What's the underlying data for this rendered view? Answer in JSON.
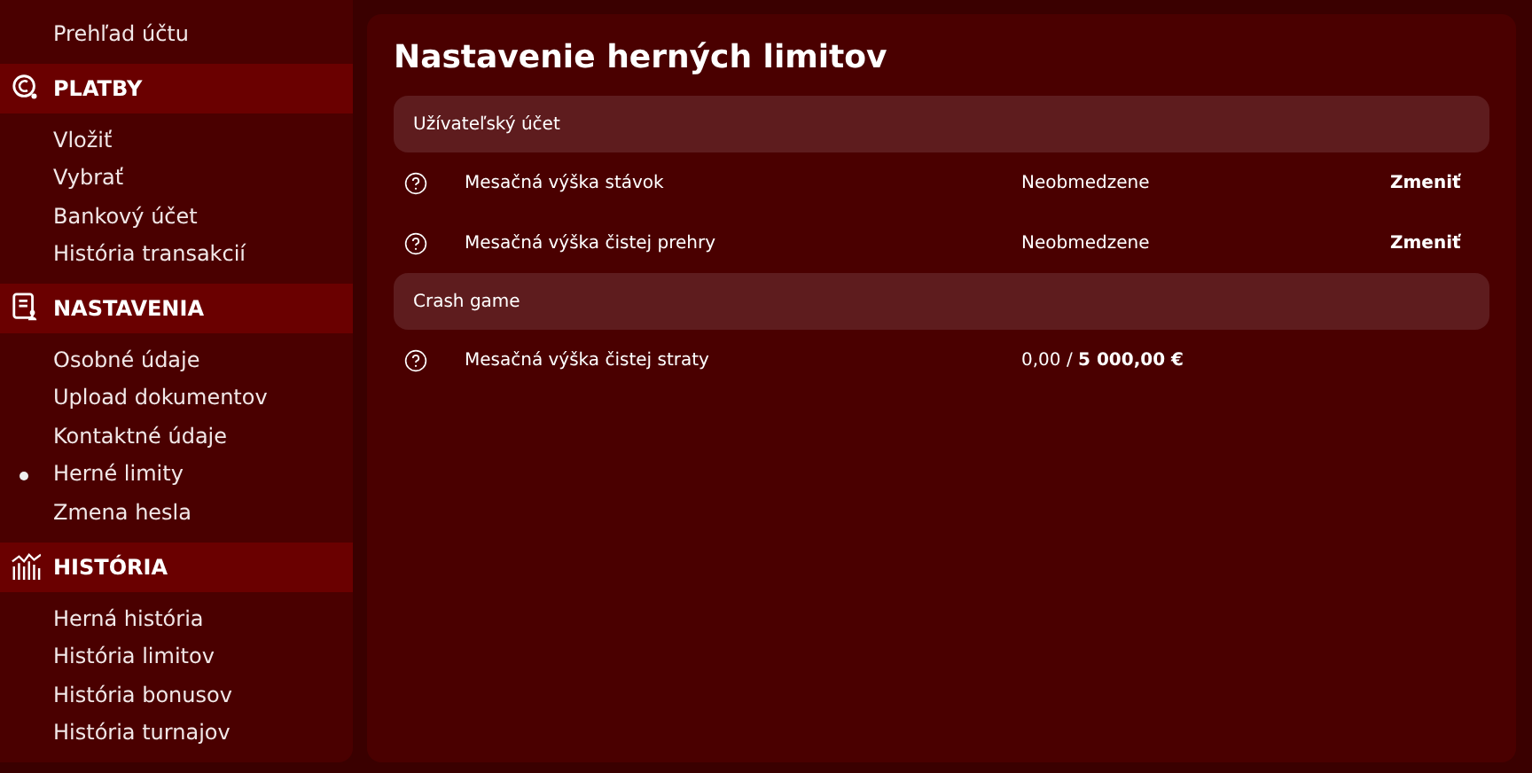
{
  "sidebar": {
    "groups": [
      {
        "items": [
          {
            "label": "Prehľad účtu",
            "selected": false
          }
        ]
      },
      {
        "title": "PLATBY",
        "kind": "payments",
        "items": [
          {
            "label": "Vložiť",
            "selected": false
          },
          {
            "label": "Vybrať",
            "selected": false
          },
          {
            "label": "Bankový účet",
            "selected": false
          },
          {
            "label": "História transakcií",
            "selected": false
          }
        ]
      },
      {
        "title": "NASTAVENIA",
        "kind": "settings",
        "items": [
          {
            "label": "Osobné údaje",
            "selected": false
          },
          {
            "label": "Upload dokumentov",
            "selected": false
          },
          {
            "label": "Kontaktné údaje",
            "selected": false
          },
          {
            "label": "Herné limity",
            "selected": true
          },
          {
            "label": "Zmena hesla",
            "selected": false
          }
        ]
      },
      {
        "title": "HISTÓRIA",
        "kind": "history",
        "items": [
          {
            "label": "Herná história",
            "selected": false
          },
          {
            "label": "História limitov",
            "selected": false
          },
          {
            "label": "História bonusov",
            "selected": false
          },
          {
            "label": "História turnajov",
            "selected": false
          }
        ]
      }
    ]
  },
  "main": {
    "title": "Nastavenie herných limitov",
    "sections": [
      {
        "title": "Užívateľský účet",
        "rows": [
          {
            "label": "Mesačná výška stávok",
            "value": "Neobmedzene",
            "action": "Zmeniť"
          },
          {
            "label": "Mesačná výška čistej prehry",
            "value": "Neobmedzene",
            "action": "Zmeniť"
          }
        ]
      },
      {
        "title": "Crash game",
        "rows": [
          {
            "label": "Mesačná výška čistej straty",
            "value": "0,00 / **5 000,00 €**"
          }
        ]
      }
    ]
  }
}
